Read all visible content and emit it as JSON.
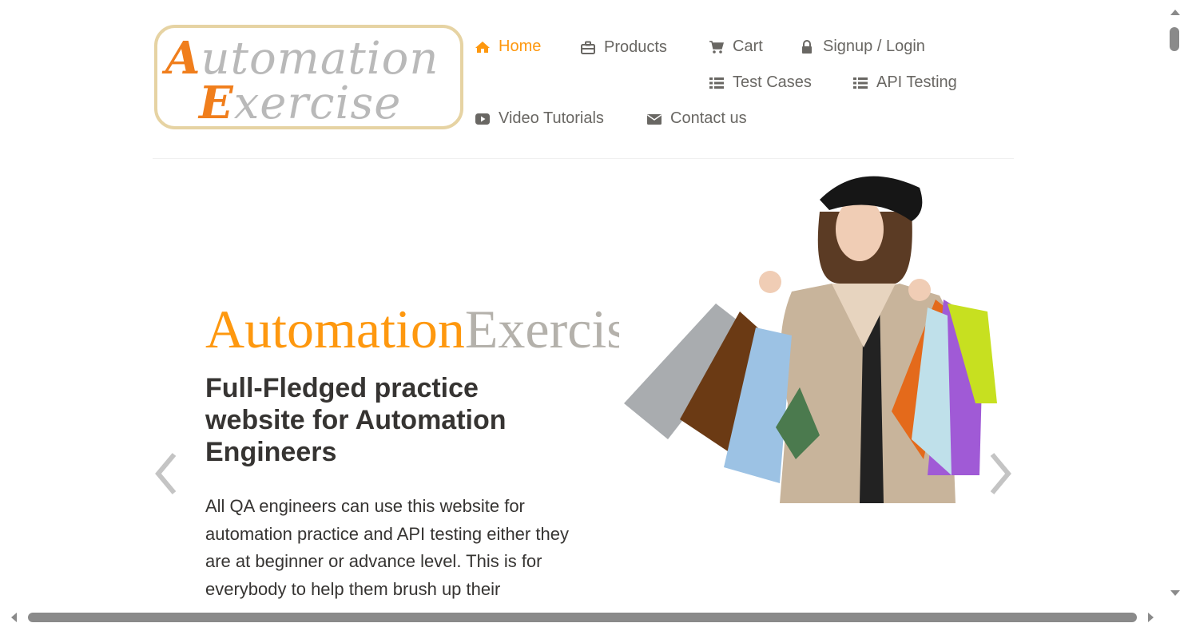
{
  "header": {
    "logo": {
      "line1_cap": "A",
      "line1_rest": "utomation",
      "line2_cap": "E",
      "line2_rest": "xercise"
    },
    "nav": {
      "home": "Home",
      "products": "Products",
      "cart": "Cart",
      "signup_login": "Signup / Login",
      "test_cases": "Test Cases",
      "api_testing": "API Testing",
      "video_tutorials": "Video Tutorials",
      "contact_us": "Contact us"
    },
    "colors": {
      "active": "#fe980f",
      "nav_text": "#696763"
    }
  },
  "slider": {
    "title_part1": "Automation",
    "title_part2": "Exercise",
    "heading": "Full-Fledged practice website for Automation Engineers",
    "text": "All QA engineers can use this website for automation practice and API testing either they are at beginner or advance level. This is for everybody to help them brush up their",
    "prev_icon": "chevron-left-icon",
    "next_icon": "chevron-right-icon",
    "image": "woman-with-shopping-bags"
  }
}
